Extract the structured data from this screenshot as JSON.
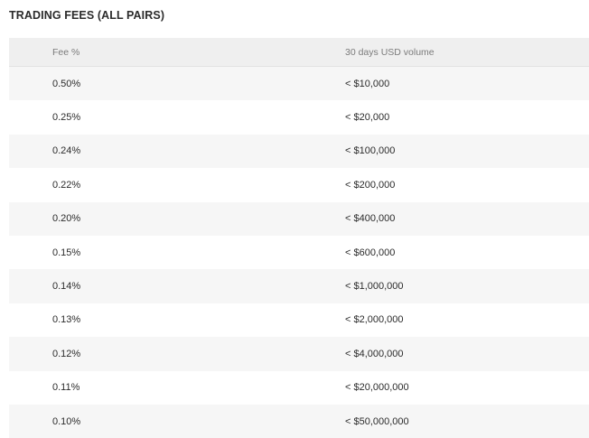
{
  "title": "TRADING FEES (ALL PAIRS)",
  "table": {
    "headers": {
      "fee": "Fee %",
      "volume": "30 days USD volume"
    },
    "rows": [
      {
        "fee": "0.50%",
        "volume": "< $10,000"
      },
      {
        "fee": "0.25%",
        "volume": "< $20,000"
      },
      {
        "fee": "0.24%",
        "volume": "< $100,000"
      },
      {
        "fee": "0.22%",
        "volume": "< $200,000"
      },
      {
        "fee": "0.20%",
        "volume": "< $400,000"
      },
      {
        "fee": "0.15%",
        "volume": "< $600,000"
      },
      {
        "fee": "0.14%",
        "volume": "< $1,000,000"
      },
      {
        "fee": "0.13%",
        "volume": "< $2,000,000"
      },
      {
        "fee": "0.12%",
        "volume": "< $4,000,000"
      },
      {
        "fee": "0.11%",
        "volume": "< $20,000,000"
      },
      {
        "fee": "0.10%",
        "volume": "< $50,000,000"
      }
    ]
  }
}
